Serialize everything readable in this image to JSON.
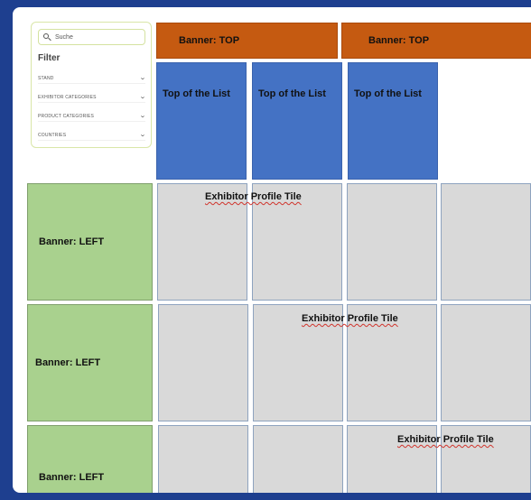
{
  "filter": {
    "search_placeholder": "Suche",
    "title": "Filter",
    "rows": [
      {
        "label": "STAND"
      },
      {
        "label": "EXHIBITOR CATEGORIES"
      },
      {
        "label": "PRODUCT CATEGORIES"
      },
      {
        "label": "COUNTRIES"
      }
    ]
  },
  "banners": {
    "top": [
      "Banner: TOP",
      "Banner: TOP"
    ],
    "top_of_list": [
      "Top of the List",
      "Top of the List",
      "Top of the List"
    ],
    "left": [
      "Banner: LEFT",
      "Banner: LEFT",
      "Banner: LEFT"
    ]
  },
  "tiles": {
    "label": "Exhibitor Profile Tile"
  },
  "colors": {
    "background": "#1e3f8f",
    "banner_top": "#c55a11",
    "top_of_list": "#4472c4",
    "banner_left": "#a9d18e",
    "tile": "#d9d9d9"
  }
}
